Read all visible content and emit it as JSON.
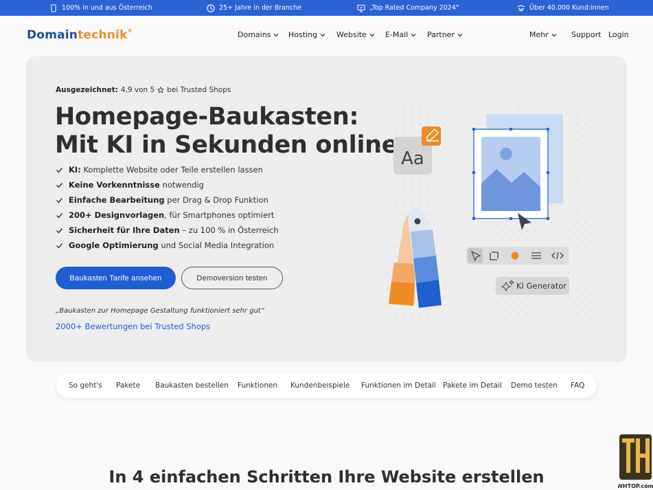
{
  "topbar": {
    "items": [
      {
        "icon": "austria-flag-icon",
        "text": "100% in und aus Österreich"
      },
      {
        "icon": "clock-icon",
        "text": "25+ Jahre in der Branche"
      },
      {
        "icon": "award-icon",
        "text": "„Top Rated Company 2024“"
      },
      {
        "icon": "users-icon",
        "text": "Über 40.000 Kund:innen"
      }
    ]
  },
  "brand": {
    "part1": "Domain",
    "part2": "technik",
    "mark": "®"
  },
  "nav": {
    "items": [
      "Domains",
      "Hosting",
      "Website",
      "E-Mail",
      "Partner"
    ],
    "more": "Mehr",
    "support": "Support",
    "login": "Login"
  },
  "hero": {
    "rating_label": "Ausgezeichnet:",
    "rating_value": "4,9 von 5",
    "rating_source": "bei Trusted Shops",
    "headline_line1": "Homepage-Baukasten:",
    "headline_line2": "Mit KI in Sekunden online",
    "features": [
      {
        "bold": "KI:",
        "text": " Komplette Website oder Teile erstellen lassen"
      },
      {
        "bold": "Keine Vorkenntnisse",
        "text": " notwendig"
      },
      {
        "bold": "Einfache Bearbeitung",
        "text": " per Drag & Drop Funktion"
      },
      {
        "bold": "200+ Designvorlagen",
        "text": ", für Smartphones optimiert"
      },
      {
        "bold": "Sicherheit für Ihre Daten",
        "text": " – zu 100 % in Österreich"
      },
      {
        "bold": "Google Optimierung",
        "text": " und Social Media Integration"
      }
    ],
    "cta_primary": "Baukasten Tarife ansehen",
    "cta_secondary": "Demoversion testen",
    "quote": "„Baukasten zur Homepage Gestaltung funktioniert sehr gut“",
    "reviews_link": "2000+ Bewertungen bei Trusted Shops"
  },
  "illustration": {
    "font_sample": "Aa",
    "ki_button": "KI Generator",
    "colors": {
      "blue": "#2a63d4",
      "orange": "#f08a24",
      "light_blue": "#c9dbf5"
    }
  },
  "subnav": {
    "items": [
      "So geht's",
      "Pakete",
      "Baukasten bestellen",
      "Funktionen",
      "Kundenbeispiele",
      "Funktionen im Detail",
      "Pakete im Detail",
      "Demo testen",
      "FAQ"
    ]
  },
  "section": {
    "title": "In 4 einfachen Schritten Ihre Website erstellen"
  },
  "watermark": {
    "text": "WHTOP.com"
  }
}
